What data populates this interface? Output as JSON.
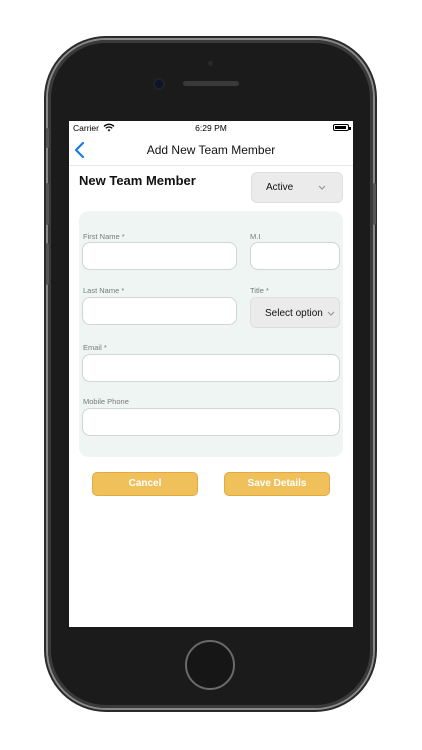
{
  "status_bar": {
    "carrier": "Carrier",
    "time": "6:29 PM",
    "battery_level": 0.9
  },
  "nav": {
    "title": "Add New Team Member",
    "back_icon": "chevron-left-icon"
  },
  "form": {
    "section_title": "New Team Member",
    "status_select": {
      "value": "Active"
    },
    "fields": {
      "first_name": {
        "label": "First Name *",
        "value": ""
      },
      "middle_initial": {
        "label": "M.I",
        "value": ""
      },
      "last_name": {
        "label": "Last Name *",
        "value": ""
      },
      "title": {
        "label": "Title *",
        "value": "Select option"
      },
      "email": {
        "label": "Email *",
        "value": ""
      },
      "mobile_phone": {
        "label": "Mobile Phone",
        "value": ""
      }
    }
  },
  "actions": {
    "cancel_label": "Cancel",
    "save_label": "Save Details"
  },
  "colors": {
    "accent": "#f0c05a",
    "card_bg": "#eef5f2",
    "nav_tint": "#1a7ae8"
  }
}
